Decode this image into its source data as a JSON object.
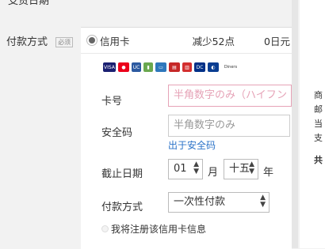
{
  "top": {
    "cut_text": "支货日期"
  },
  "payment": {
    "label": "付款方式",
    "required_badge": "必须",
    "option": {
      "name": "信用卡",
      "points": "减少52点",
      "amount": "0日元"
    }
  },
  "card_logos": [
    "VISA",
    "MC",
    "UC",
    "JCB",
    "AMEX",
    "DC",
    "Diners"
  ],
  "card_form": {
    "card_number_label": "卡号",
    "card_number_placeholder": "半角数字のみ（ハイフン",
    "security_code_label": "安全码",
    "security_code_placeholder": "半角数字のみ",
    "security_code_link": "出于安全码",
    "expiry_label": "截止日期",
    "expiry_month": "01",
    "month_unit": "月",
    "expiry_year": "十五",
    "year_unit": "年",
    "pay_method_label": "付款方式",
    "pay_method_value": "一次性付款",
    "save_card_label": "我将注册该信用卡信息"
  },
  "right_column": [
    "商",
    "邮",
    "当",
    "支",
    "共"
  ]
}
